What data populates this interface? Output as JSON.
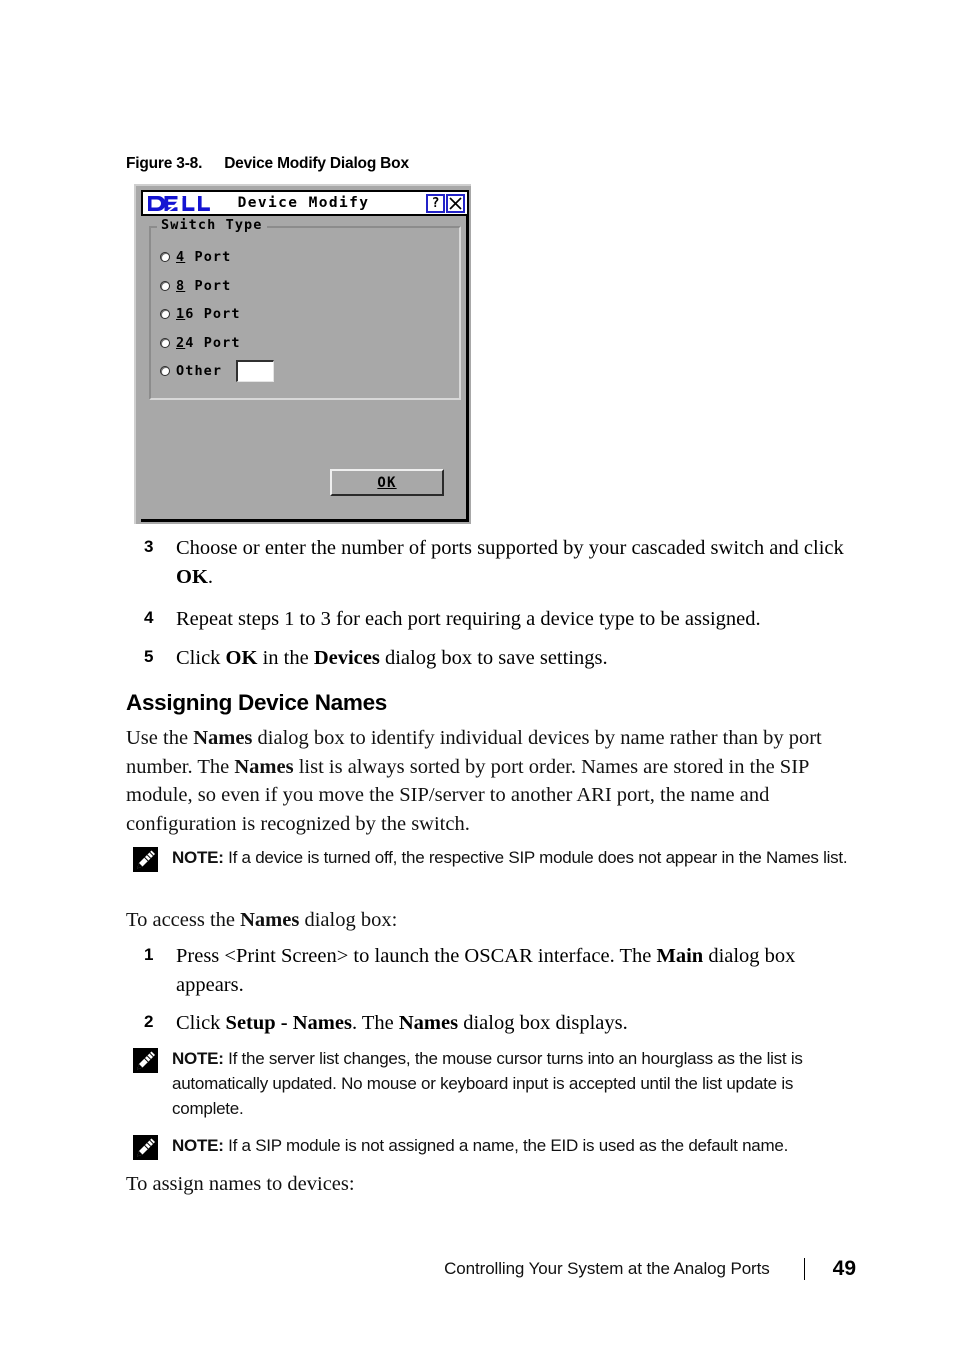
{
  "figure": {
    "number": "Figure 3-8.",
    "title": "Device Modify Dialog Box"
  },
  "dialog": {
    "logo_alt": "DELL",
    "title": "Device Modify",
    "help_button": "?",
    "close_button": "X",
    "group_legend": "Switch Type",
    "radio_options": [
      {
        "mnemonic": "4",
        "rest": " Port",
        "selected": false
      },
      {
        "mnemonic": "8",
        "rest": " Port",
        "selected": false
      },
      {
        "mnemonic": "1",
        "rest": "6 Port",
        "selected": false
      },
      {
        "mnemonic": "2",
        "rest": "4 Port",
        "selected": false
      },
      {
        "mnemonic": "",
        "rest": "Other",
        "selected": false,
        "has_input": true,
        "input_value": ""
      }
    ],
    "ok_label": "OK"
  },
  "steps_top": [
    {
      "number": "3",
      "text_parts": [
        {
          "t": "Choose or enter the number of ports supported by your cascaded switch and click ",
          "b": false
        },
        {
          "t": "OK",
          "b": true
        },
        {
          "t": ".",
          "b": false
        }
      ]
    },
    {
      "number": "4",
      "text_parts": [
        {
          "t": "Repeat steps 1 to 3 for each port requiring a device type to be assigned.",
          "b": false
        }
      ]
    },
    {
      "number": "5",
      "text_parts": [
        {
          "t": "Click ",
          "b": false
        },
        {
          "t": "OK",
          "b": true
        },
        {
          "t": " in the ",
          "b": false
        },
        {
          "t": "Devices",
          "b": true
        },
        {
          "t": " dialog box to save settings.",
          "b": false
        }
      ]
    }
  ],
  "section": {
    "heading": "Assigning Device Names",
    "paragraph_parts": [
      {
        "t": "Use the ",
        "b": false
      },
      {
        "t": "Names",
        "b": true
      },
      {
        "t": " dialog box to identify individual devices by name rather than by port number. The ",
        "b": false
      },
      {
        "t": "Names",
        "b": true
      },
      {
        "t": " list is always sorted by port order. Names are stored in the SIP module, so even if you move the SIP/server to another ARI port, the name and configuration is recognized by the switch.",
        "b": false
      }
    ]
  },
  "note_1": {
    "label": "NOTE:",
    "text": " If a device is turned off, the respective SIP module does not appear in the Names list."
  },
  "lead_in_1": {
    "parts": [
      {
        "t": "To access the ",
        "b": false
      },
      {
        "t": "Names",
        "b": true
      },
      {
        "t": " dialog box:",
        "b": false
      }
    ]
  },
  "steps_bottom": [
    {
      "number": "1",
      "text_parts": [
        {
          "t": "Press <Print Screen> to launch the OSCAR interface. The ",
          "b": false
        },
        {
          "t": "Main",
          "b": true
        },
        {
          "t": " dialog box appears.",
          "b": false
        }
      ]
    },
    {
      "number": "2",
      "text_parts": [
        {
          "t": "Click ",
          "b": false
        },
        {
          "t": "Setup - Names",
          "b": true
        },
        {
          "t": ". The ",
          "b": false
        },
        {
          "t": "Names",
          "b": true
        },
        {
          "t": " dialog box displays.",
          "b": false
        }
      ]
    }
  ],
  "note_2": {
    "label": "NOTE:",
    "text": " If the server list changes, the mouse cursor turns into an hourglass as the list is automatically updated. No mouse or keyboard input is accepted until the list update is complete."
  },
  "note_3": {
    "label": "NOTE:",
    "text": "  If a SIP module is not assigned a name, the EID is used as the default name."
  },
  "lead_in_2": {
    "parts": [
      {
        "t": "To assign names to devices:",
        "b": false
      }
    ]
  },
  "footer": {
    "title": "Controlling Your System at the Analog Ports",
    "page_number": "49"
  },
  "colors": {
    "dell_blue": "#1414d2",
    "dialog_gray": "#a8a8a8",
    "button_border_blue": "#2323c8"
  }
}
